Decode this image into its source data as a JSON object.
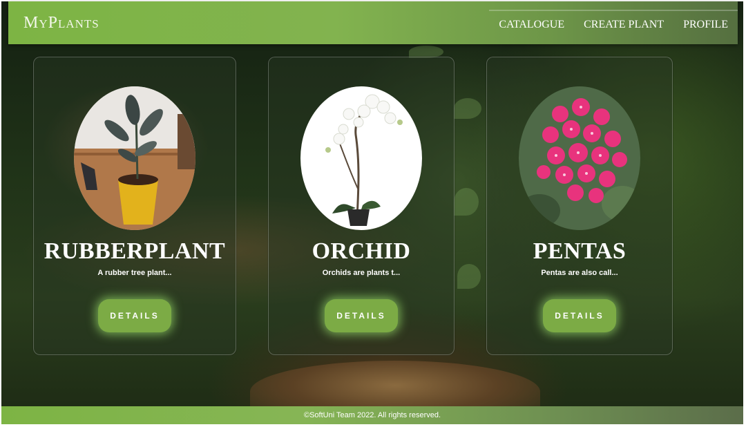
{
  "header": {
    "logo": "MyPlants",
    "nav": [
      "CATALOGUE",
      "CREATE PLANT",
      "PROFILE"
    ]
  },
  "cards": [
    {
      "name": "RUBBERPLANT",
      "description": "A rubber tree plant...",
      "button": "DETAILS"
    },
    {
      "name": "ORCHID",
      "description": "Orchids are plants t...",
      "button": "DETAILS"
    },
    {
      "name": "PENTAS",
      "description": "Pentas are also call...",
      "button": "DETAILS"
    }
  ],
  "footer": {
    "text": "©SoftUni Team 2022. All rights reserved."
  },
  "colors": {
    "accent": "#7cab45",
    "header_start": "#7db444",
    "text": "#ffffff"
  }
}
